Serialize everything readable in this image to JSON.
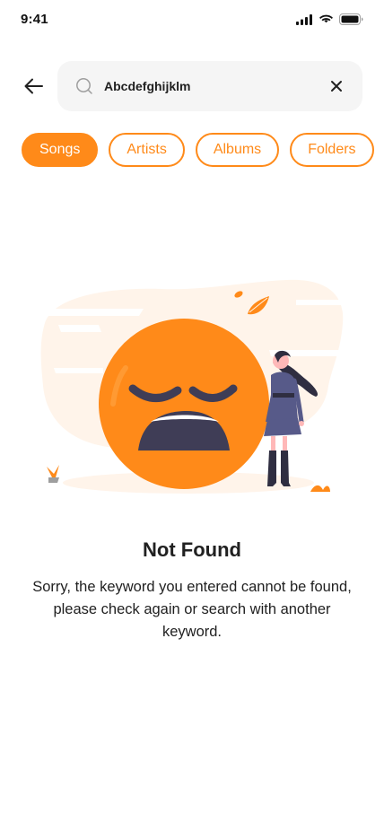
{
  "status_bar": {
    "time": "9:41"
  },
  "search": {
    "value": "Abcdefghijklm",
    "icon": "search-icon",
    "clear_icon": "close-icon",
    "back_icon": "arrow-left-icon"
  },
  "filters": [
    {
      "label": "Songs",
      "active": true
    },
    {
      "label": "Artists",
      "active": false
    },
    {
      "label": "Albums",
      "active": false
    },
    {
      "label": "Folders",
      "active": false
    }
  ],
  "empty_state": {
    "title": "Not Found",
    "message": "Sorry, the keyword you entered cannot be found, please check again or search with another keyword."
  },
  "colors": {
    "accent": "#FF8A19",
    "text": "#212121",
    "search_bg": "#F5F5F5"
  }
}
